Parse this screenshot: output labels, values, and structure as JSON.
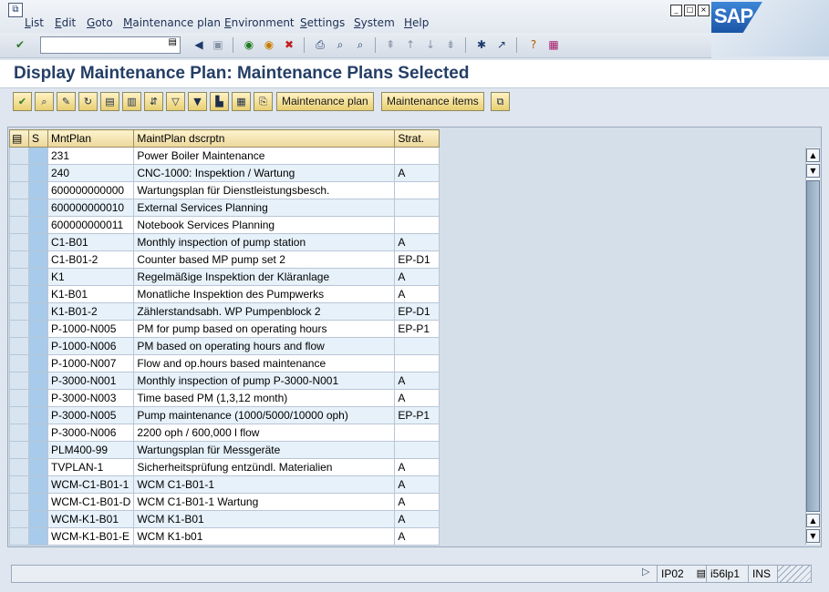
{
  "menu": [
    "List",
    "Edit",
    "Goto",
    "Maintenance plan",
    "Environment",
    "Settings",
    "System",
    "Help"
  ],
  "logo": "SAP",
  "title": "Display Maintenance Plan: Maintenance Plans Selected",
  "app_buttons": {
    "maintenance_plan": "Maintenance plan",
    "maintenance_items": "Maintenance items"
  },
  "grid": {
    "headers": {
      "s": "S",
      "mntplan": "MntPlan",
      "descr": "MaintPlan dscrptn",
      "strat": "Strat."
    },
    "rows": [
      {
        "plan": "231",
        "descr": "Power Boiler Maintenance",
        "strat": ""
      },
      {
        "plan": "240",
        "descr": "CNC-1000: Inspektion / Wartung",
        "strat": "A"
      },
      {
        "plan": "600000000000",
        "descr": "Wartungsplan für Dienstleistungsbesch.",
        "strat": ""
      },
      {
        "plan": "600000000010",
        "descr": "External Services Planning",
        "strat": ""
      },
      {
        "plan": "600000000011",
        "descr": "Notebook Services Planning",
        "strat": ""
      },
      {
        "plan": "C1-B01",
        "descr": "Monthly inspection of pump station",
        "strat": "A"
      },
      {
        "plan": "C1-B01-2",
        "descr": "Counter based MP pump set 2",
        "strat": "EP-D1"
      },
      {
        "plan": "K1",
        "descr": "Regelmäßige Inspektion der Kläranlage",
        "strat": "A"
      },
      {
        "plan": "K1-B01",
        "descr": "Monatliche Inspektion des Pumpwerks",
        "strat": "A"
      },
      {
        "plan": "K1-B01-2",
        "descr": "Zählerstandsabh. WP Pumpenblock 2",
        "strat": "EP-D1"
      },
      {
        "plan": "P-1000-N005",
        "descr": "PM for pump based on operating hours",
        "strat": "EP-P1"
      },
      {
        "plan": "P-1000-N006",
        "descr": "PM based on operating hours and flow",
        "strat": ""
      },
      {
        "plan": "P-1000-N007",
        "descr": "Flow and op.hours based maintenance",
        "strat": ""
      },
      {
        "plan": "P-3000-N001",
        "descr": "Monthly inspection of pump P-3000-N001",
        "strat": "A"
      },
      {
        "plan": "P-3000-N003",
        "descr": "Time based PM (1,3,12 month)",
        "strat": "A"
      },
      {
        "plan": "P-3000-N005",
        "descr": "Pump maintenance (1000/5000/10000 oph)",
        "strat": "EP-P1"
      },
      {
        "plan": "P-3000-N006",
        "descr": "2200 oph / 600,000 l flow",
        "strat": ""
      },
      {
        "plan": "PLM400-99",
        "descr": "Wartungsplan für Messgeräte",
        "strat": ""
      },
      {
        "plan": "TVPLAN-1",
        "descr": "Sicherheitsprüfung entzündl. Materialien",
        "strat": "A"
      },
      {
        "plan": "WCM-C1-B01-1",
        "descr": "WCM C1-B01-1",
        "strat": "A"
      },
      {
        "plan": "WCM-C1-B01-D",
        "descr": "WCM C1-B01-1 Wartung",
        "strat": "A"
      },
      {
        "plan": "WCM-K1-B01",
        "descr": "WCM K1-B01",
        "strat": "A"
      },
      {
        "plan": "WCM-K1-B01-E",
        "descr": "WCM K1-b01",
        "strat": "A"
      }
    ]
  },
  "status": {
    "transaction": "IP02",
    "system": "i56lp1",
    "mode": "INS"
  }
}
